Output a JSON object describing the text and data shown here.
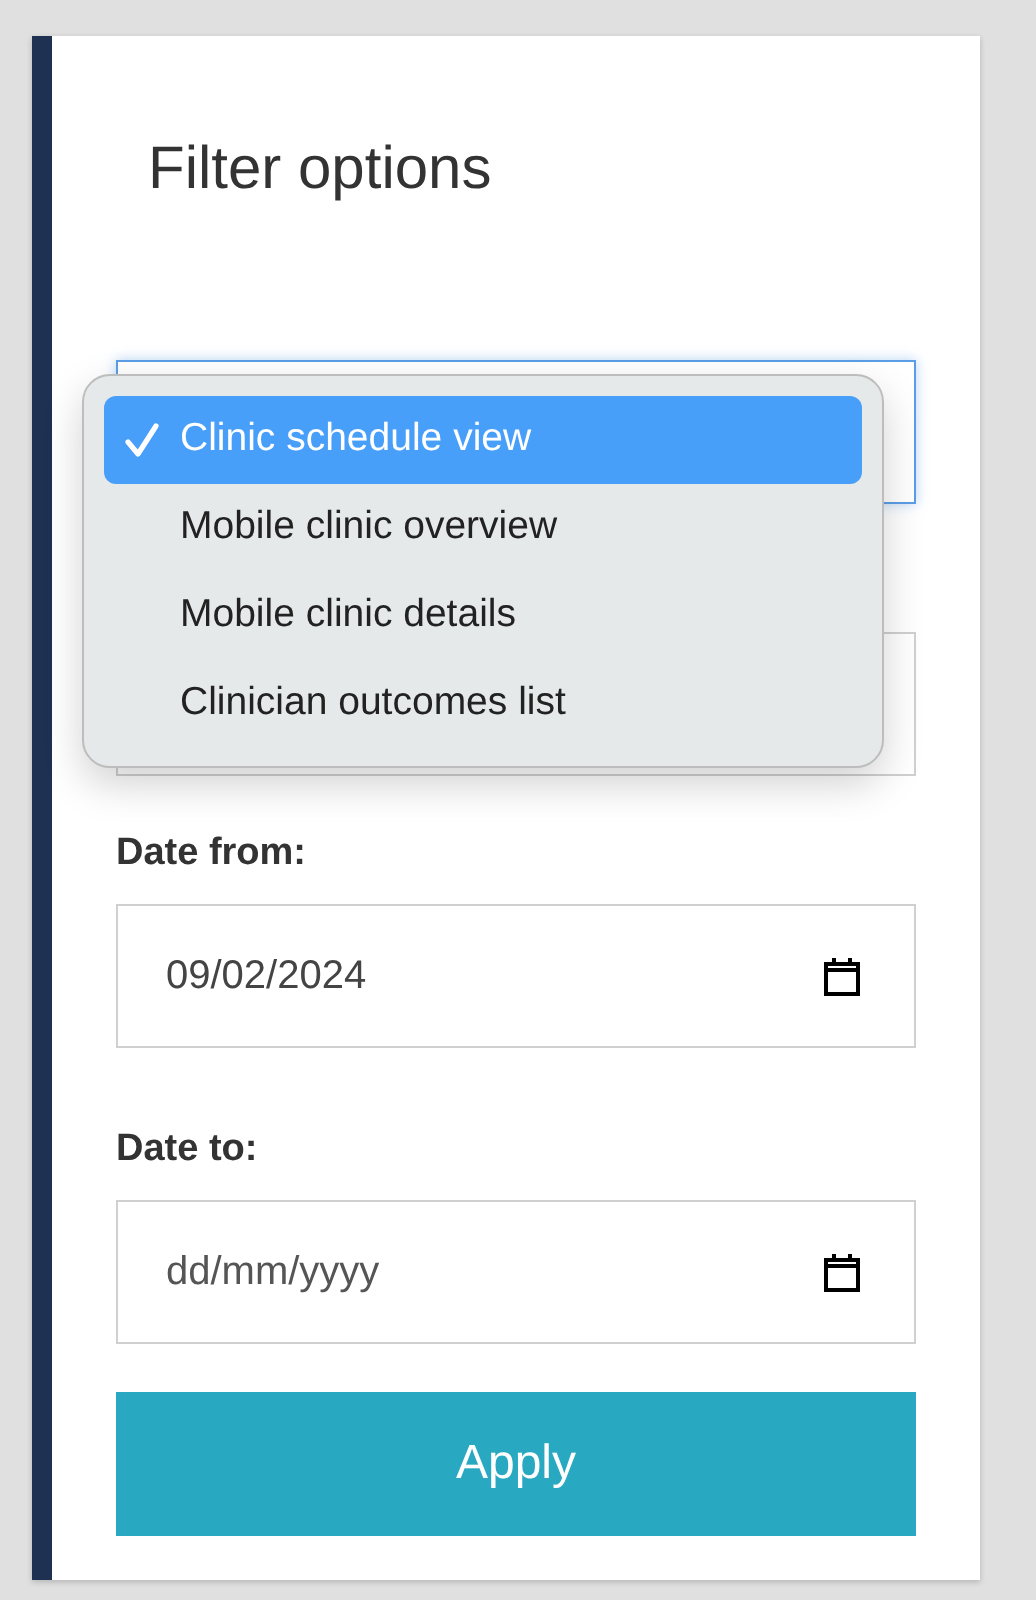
{
  "title": "Filter options",
  "menu": {
    "options": [
      {
        "label": "Clinic schedule view",
        "selected": true
      },
      {
        "label": "Mobile clinic overview",
        "selected": false
      },
      {
        "label": "Mobile clinic details",
        "selected": false
      },
      {
        "label": "Clinician outcomes list",
        "selected": false
      }
    ]
  },
  "date_from": {
    "label": "Date from:",
    "value": "09/02/2024"
  },
  "date_to": {
    "label": "Date to:",
    "placeholder": "dd/mm/yyyy"
  },
  "apply_button": "Apply"
}
